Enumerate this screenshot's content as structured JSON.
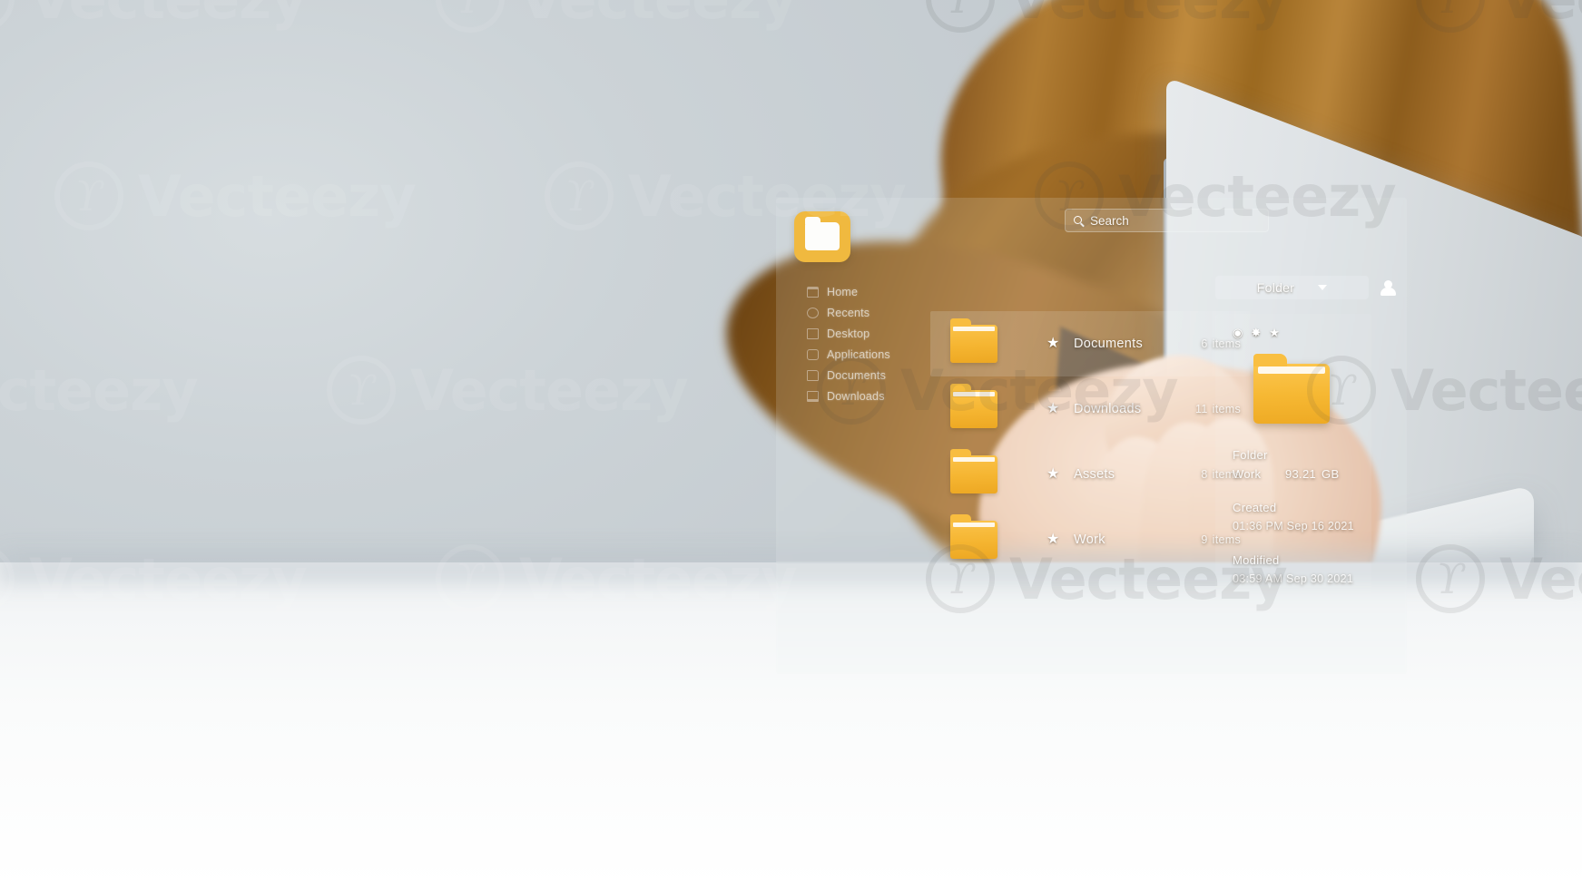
{
  "app": {
    "icon_name": "folder-app-icon"
  },
  "search": {
    "placeholder": "Search",
    "value": "Search",
    "icon": "search-icon"
  },
  "sidebar": {
    "items": [
      {
        "label": "Home",
        "icon": "home-icon"
      },
      {
        "label": "Recents",
        "icon": "clock-icon"
      },
      {
        "label": "Desktop",
        "icon": "desktop-icon"
      },
      {
        "label": "Applications",
        "icon": "apps-icon"
      },
      {
        "label": "Documents",
        "icon": "document-icon"
      },
      {
        "label": "Downloads",
        "icon": "download-icon"
      }
    ]
  },
  "file_list": {
    "rows": [
      {
        "name": "Documents",
        "count": "6",
        "unit": "items",
        "starred": true,
        "selected": true
      },
      {
        "name": "Downloads",
        "count": "11",
        "unit": "items",
        "starred": true,
        "selected": false
      },
      {
        "name": "Assets",
        "count": "8",
        "unit": "items",
        "starred": true,
        "selected": false
      },
      {
        "name": "Work",
        "count": "9",
        "unit": "items",
        "starred": true,
        "selected": false
      }
    ],
    "star_glyph": "★"
  },
  "toolbar": {
    "dropdown_label": "Folder",
    "dropdown_icon": "chevron-down-icon",
    "account_icon": "user-avatar-icon"
  },
  "details": {
    "actions": [
      {
        "icon": "eye-icon",
        "glyph": "◉"
      },
      {
        "icon": "pin-icon",
        "glyph": "✸"
      },
      {
        "icon": "star-icon",
        "glyph": "★"
      }
    ],
    "type_label": "Folder",
    "name": "Work",
    "size": "93.21",
    "size_unit": "GB",
    "created_label": "Created",
    "created_value": "01:36 PM Sep 16  2021",
    "modified_label": "Modified",
    "modified_value": "03:59 AM Sep 30  2021"
  },
  "watermark": {
    "text": "Vecteezy",
    "mark": "ϒ"
  },
  "colors": {
    "folder_yellow": "#f6b833",
    "app_icon_yellow": "#f0b93f",
    "hud_text": "#ffffff",
    "background": "#cfd6da",
    "shirt": "#a3702c",
    "desk": "#ffffff"
  }
}
